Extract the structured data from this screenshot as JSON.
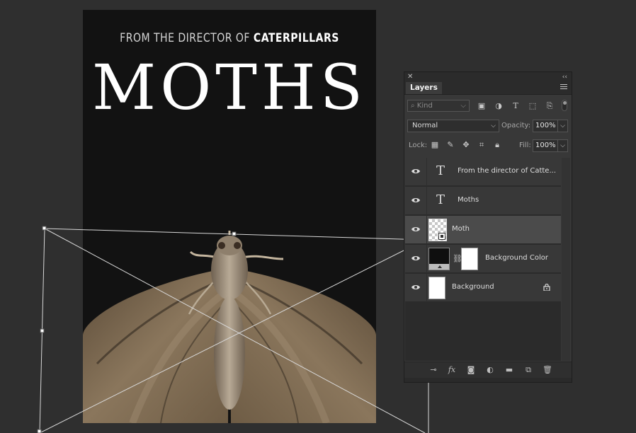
{
  "document": {
    "tagline_prefix": "FROM THE DIRECTOR OF ",
    "tagline_bold": "CATERPILLARS",
    "title": "MOTHS",
    "background": "#121212"
  },
  "panel": {
    "tab": "Layers",
    "filter_kind": "Kind",
    "blend_mode": "Normal",
    "opacity_label": "Opacity:",
    "opacity_value": "100%",
    "lock_label": "Lock:",
    "fill_label": "Fill:",
    "fill_value": "100%",
    "layers": [
      {
        "name": "From the director of Catte...",
        "kind": "text",
        "visible": true
      },
      {
        "name": "Moths",
        "kind": "text",
        "visible": true
      },
      {
        "name": "Moth",
        "kind": "smart-object",
        "visible": true,
        "selected": true
      },
      {
        "name": "Background Color",
        "kind": "fill-with-mask",
        "visible": true
      },
      {
        "name": "Background",
        "kind": "locked-background",
        "visible": true
      }
    ],
    "filter_icons": [
      "image-filter-icon",
      "adjustment-filter-icon",
      "text-filter-icon",
      "shape-filter-icon",
      "smart-object-filter-icon"
    ],
    "lock_icons": [
      "lock-transparent-icon",
      "lock-pixels-icon",
      "lock-position-icon",
      "lock-artboard-icon",
      "lock-all-icon"
    ],
    "footer_icons": [
      "link-layers-icon",
      "fx-icon",
      "add-mask-icon",
      "adjustment-layer-icon",
      "new-group-icon",
      "new-layer-icon",
      "trash-icon"
    ]
  }
}
